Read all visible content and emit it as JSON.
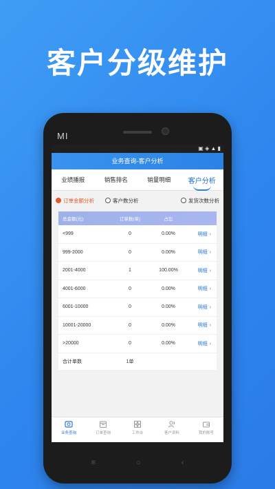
{
  "headline": "客户分级维护",
  "phone": {
    "logo": "MI"
  },
  "app": {
    "title": "业务查询-客户分析",
    "tabs": [
      "业绩播报",
      "销售排名",
      "销量明细",
      "客户分析"
    ],
    "filters": [
      "订单金额分析",
      "客户数分析",
      "发货次数分析"
    ],
    "table": {
      "headers": [
        "总金额(元)",
        "订单数(单)",
        "占比"
      ],
      "rows": [
        {
          "range": "<999",
          "count": "0",
          "pct": "0.00%",
          "link": "明细"
        },
        {
          "range": "999-2000",
          "count": "0",
          "pct": "0.00%",
          "link": "明细"
        },
        {
          "range": "2001-4000",
          "count": "1",
          "pct": "100.00%",
          "link": "明细"
        },
        {
          "range": "4001-6000",
          "count": "0",
          "pct": "0.00%",
          "link": "明细"
        },
        {
          "range": "6001-10000",
          "count": "0",
          "pct": "0.00%",
          "link": "明细"
        },
        {
          "range": "10001-20000",
          "count": "0",
          "pct": "0.00%",
          "link": "明细"
        },
        {
          "range": ">20000",
          "count": "0",
          "pct": "0.00%",
          "link": "明细"
        }
      ],
      "total_label": "合计单数",
      "total_value": "1单"
    },
    "nav": [
      "业务查询",
      "订单查询",
      "工作台",
      "客户资料",
      "我的账号"
    ]
  },
  "colors": {
    "accent": "#2a78e0",
    "selected_filter": "#e4582b"
  }
}
